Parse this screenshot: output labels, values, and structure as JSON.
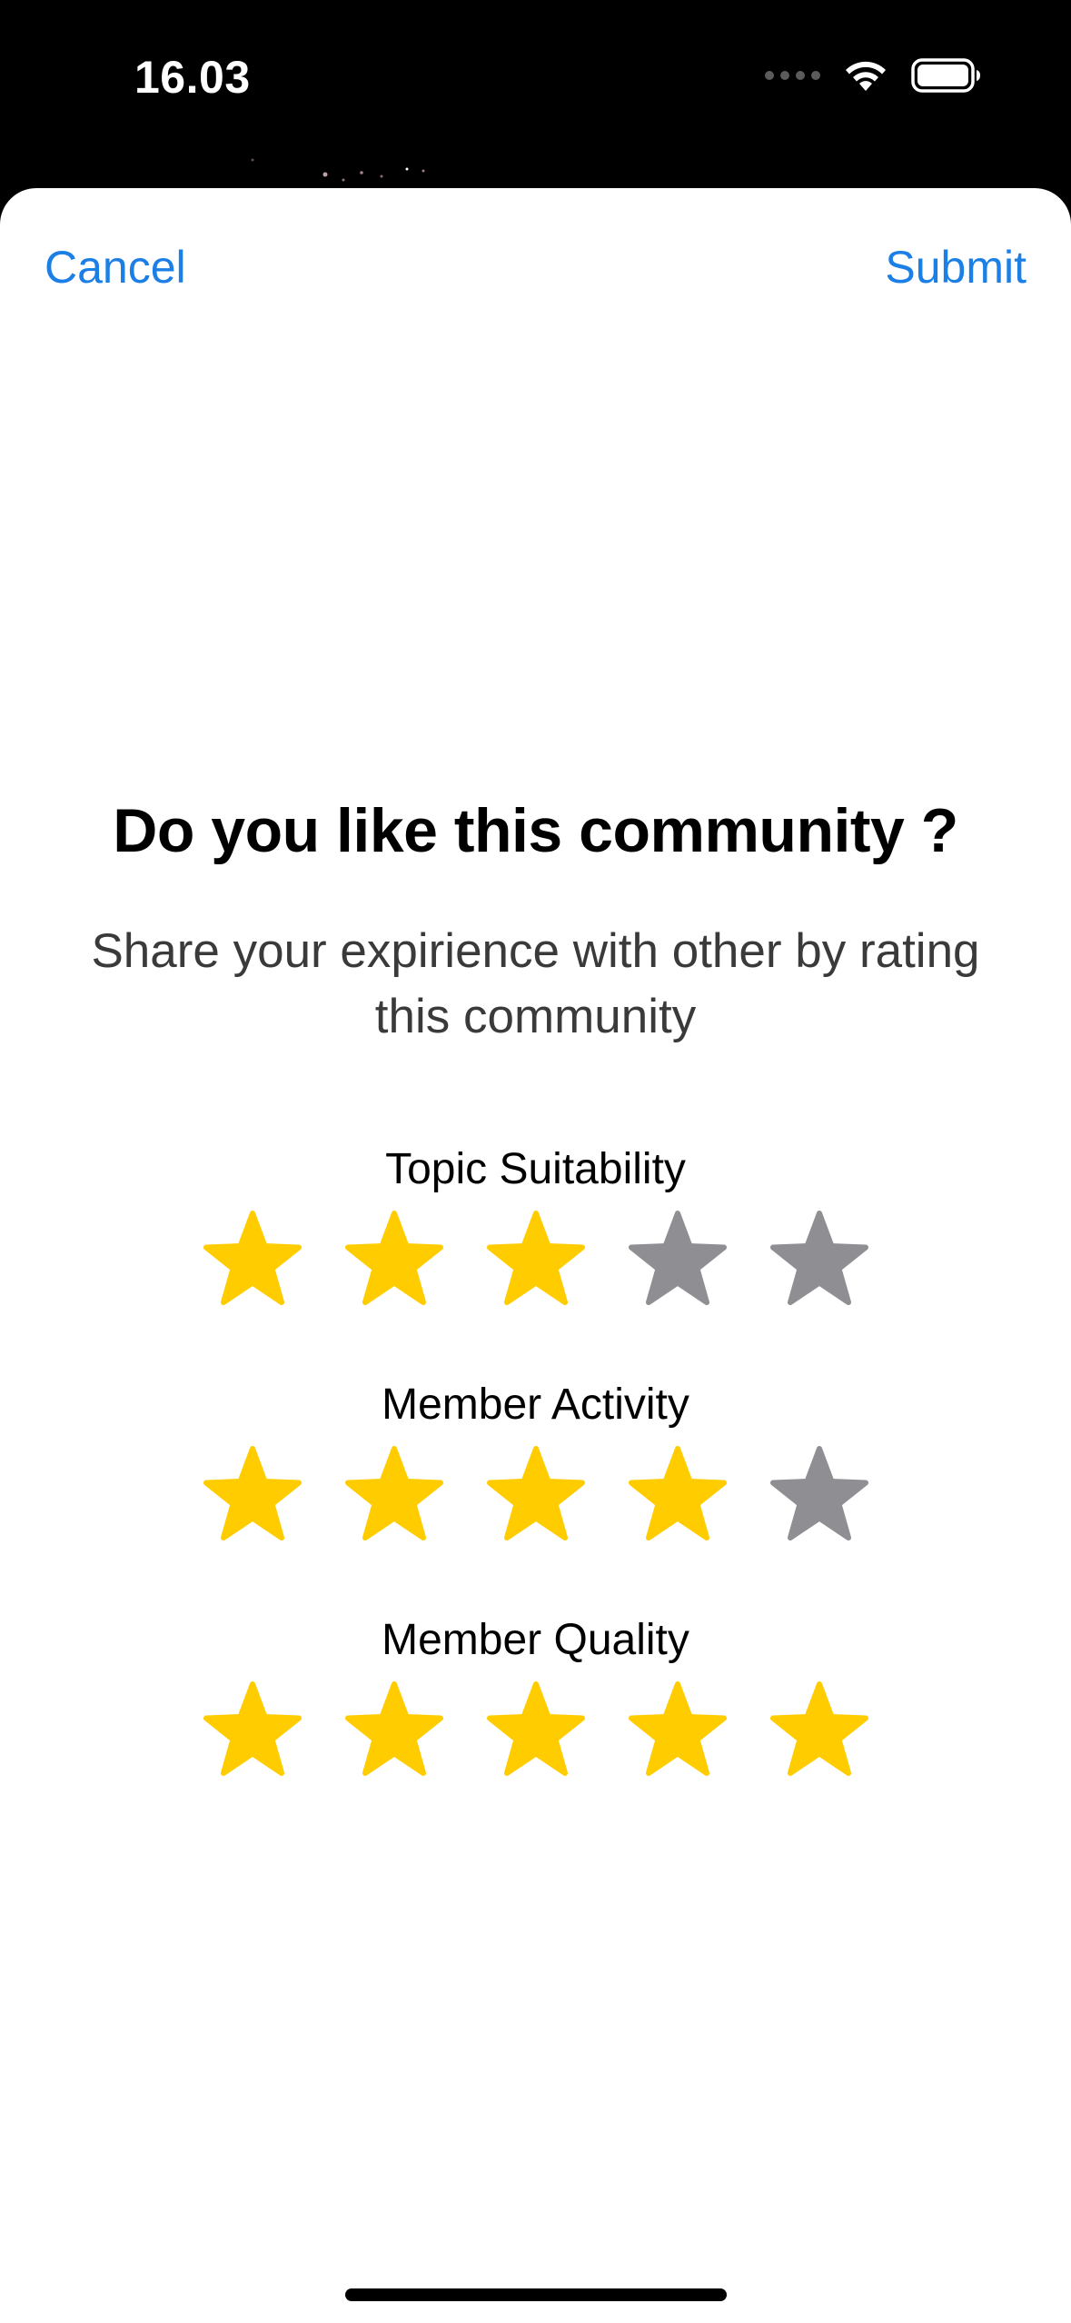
{
  "status_bar": {
    "time": "16.03"
  },
  "nav": {
    "cancel_label": "Cancel",
    "submit_label": "Submit"
  },
  "content": {
    "title": "Do you like this community ?",
    "subtitle": "Share your expirience with other by rating this community"
  },
  "ratings": [
    {
      "label": "Topic Suitability",
      "value": 3,
      "max": 5
    },
    {
      "label": "Member Activity",
      "value": 4,
      "max": 5
    },
    {
      "label": "Member Quality",
      "value": 5,
      "max": 5
    }
  ],
  "colors": {
    "accent": "#1b7fe6",
    "star_filled": "#ffcc00",
    "star_empty": "#8e8e93",
    "sheet_background": "#ffffff",
    "backdrop": "#000000"
  },
  "icons": {
    "star": "star-icon",
    "wifi": "wifi-icon",
    "battery": "battery-icon",
    "signal": "cellular-signal-icon"
  }
}
